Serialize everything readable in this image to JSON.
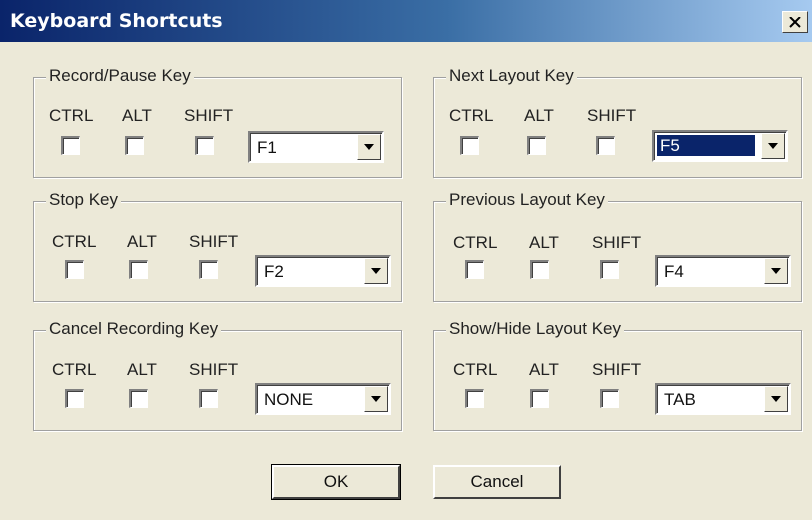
{
  "window": {
    "title": "Keyboard Shortcuts",
    "close_icon": "close-icon"
  },
  "groups": [
    {
      "title": "Record/Pause Key",
      "ctrl": "CTRL",
      "alt": "ALT",
      "shift": "SHIFT",
      "key": "F1",
      "ctrl_checked": false,
      "alt_checked": false,
      "shift_checked": false,
      "selected": false
    },
    {
      "title": "Stop Key",
      "ctrl": "CTRL",
      "alt": "ALT",
      "shift": "SHIFT",
      "key": "F2",
      "ctrl_checked": false,
      "alt_checked": false,
      "shift_checked": false,
      "selected": false
    },
    {
      "title": "Cancel Recording Key",
      "ctrl": "CTRL",
      "alt": "ALT",
      "shift": "SHIFT",
      "key": "NONE",
      "ctrl_checked": false,
      "alt_checked": false,
      "shift_checked": false,
      "selected": false
    },
    {
      "title": "Next Layout Key",
      "ctrl": "CTRL",
      "alt": "ALT",
      "shift": "SHIFT",
      "key": "F5",
      "ctrl_checked": false,
      "alt_checked": false,
      "shift_checked": false,
      "selected": true
    },
    {
      "title": "Previous Layout Key",
      "ctrl": "CTRL",
      "alt": "ALT",
      "shift": "SHIFT",
      "key": "F4",
      "ctrl_checked": false,
      "alt_checked": false,
      "shift_checked": false,
      "selected": false
    },
    {
      "title": "Show/Hide Layout Key",
      "ctrl": "CTRL",
      "alt": "ALT",
      "shift": "SHIFT",
      "key": "TAB",
      "ctrl_checked": false,
      "alt_checked": false,
      "shift_checked": false,
      "selected": false
    }
  ],
  "buttons": {
    "ok": "OK",
    "cancel": "Cancel"
  },
  "colors": {
    "titlebar_start": "#0a246a",
    "titlebar_end": "#a6caf0",
    "face": "#ece9d8",
    "selection": "#0a246a"
  }
}
